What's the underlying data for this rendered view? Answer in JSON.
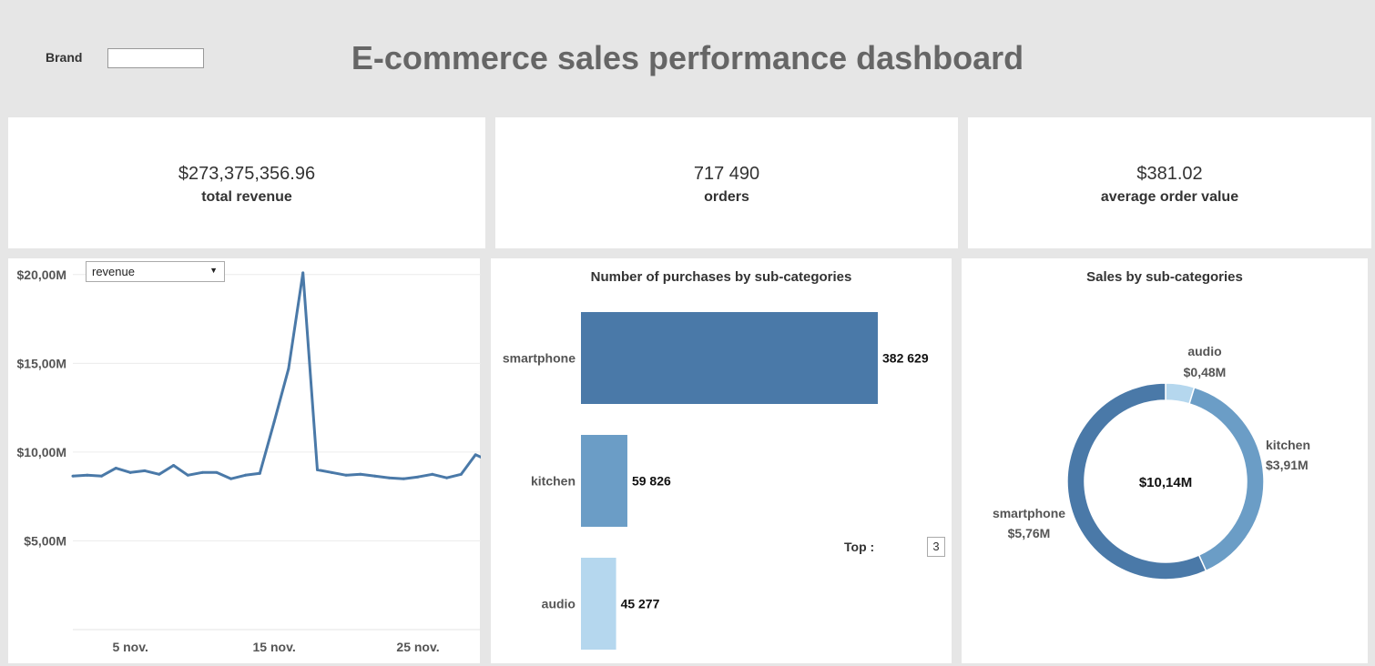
{
  "header": {
    "brand_label": "Brand",
    "brand_value": "",
    "title": "E-commerce sales performance dashboard"
  },
  "kpis": [
    {
      "value": "$273,375,356.96",
      "label": "total revenue"
    },
    {
      "value": "717 490",
      "label": "orders"
    },
    {
      "value": "$381.02",
      "label": "average order value"
    }
  ],
  "line_panel": {
    "dropdown_value": "revenue"
  },
  "purchases_panel": {
    "title": "Number of purchases by sub-categories",
    "top_label": "Top :",
    "top_value": "3"
  },
  "sales_panel": {
    "title": "Sales by sub-categories",
    "center_label": "$10,14M"
  },
  "colors": {
    "primary": "#4a79a8",
    "mid": "#6b9dc6",
    "light": "#b5d7ee",
    "background": "#e6e6e6"
  },
  "chart_data": [
    {
      "type": "line",
      "title": "",
      "x": [
        "1 nov.",
        "2 nov.",
        "3 nov.",
        "4 nov.",
        "5 nov.",
        "6 nov.",
        "7 nov.",
        "8 nov.",
        "9 nov.",
        "10 nov.",
        "11 nov.",
        "12 nov.",
        "13 nov.",
        "14 nov.",
        "15 nov.",
        "16 nov.",
        "17 nov.",
        "18 nov.",
        "19 nov.",
        "20 nov.",
        "21 nov.",
        "22 nov.",
        "23 nov.",
        "24 nov.",
        "25 nov.",
        "26 nov.",
        "27 nov.",
        "28 nov.",
        "29 nov.",
        "30 nov."
      ],
      "x_ticks": [
        "5 nov.",
        "15 nov.",
        "25 nov."
      ],
      "y_ticks": [
        "$5,00M",
        "$10,00M",
        "$15,00M",
        "$20,00M"
      ],
      "ylim": [
        0,
        20.4
      ],
      "series": [
        {
          "values": [
            8.65,
            8.7,
            8.65,
            9.1,
            8.85,
            8.95,
            8.75,
            9.25,
            8.7,
            8.85,
            8.85,
            8.5,
            8.7,
            8.8,
            11.7,
            14.7,
            20.1,
            9.0,
            8.85,
            8.7,
            8.75,
            8.65,
            8.55,
            8.5,
            8.6,
            8.75,
            8.55,
            8.75,
            9.85,
            9.5
          ]
        }
      ],
      "grid": true
    },
    {
      "type": "bar",
      "orientation": "horizontal",
      "categories": [
        "smartphone",
        "kitchen",
        "audio"
      ],
      "values": [
        382629,
        59826,
        45277
      ],
      "labels": [
        "382 629",
        "59 826",
        "45 277"
      ],
      "colors": [
        "#4a79a8",
        "#6b9dc6",
        "#b5d7ee"
      ]
    },
    {
      "type": "pie",
      "style": "donut",
      "categories": [
        "audio",
        "kitchen",
        "smartphone"
      ],
      "values": [
        0.48,
        3.91,
        5.76
      ],
      "labels": [
        "$0,48M",
        "$3,91M",
        "$5,76M"
      ],
      "colors": [
        "#b5d7ee",
        "#6b9dc6",
        "#4a79a8"
      ]
    }
  ]
}
